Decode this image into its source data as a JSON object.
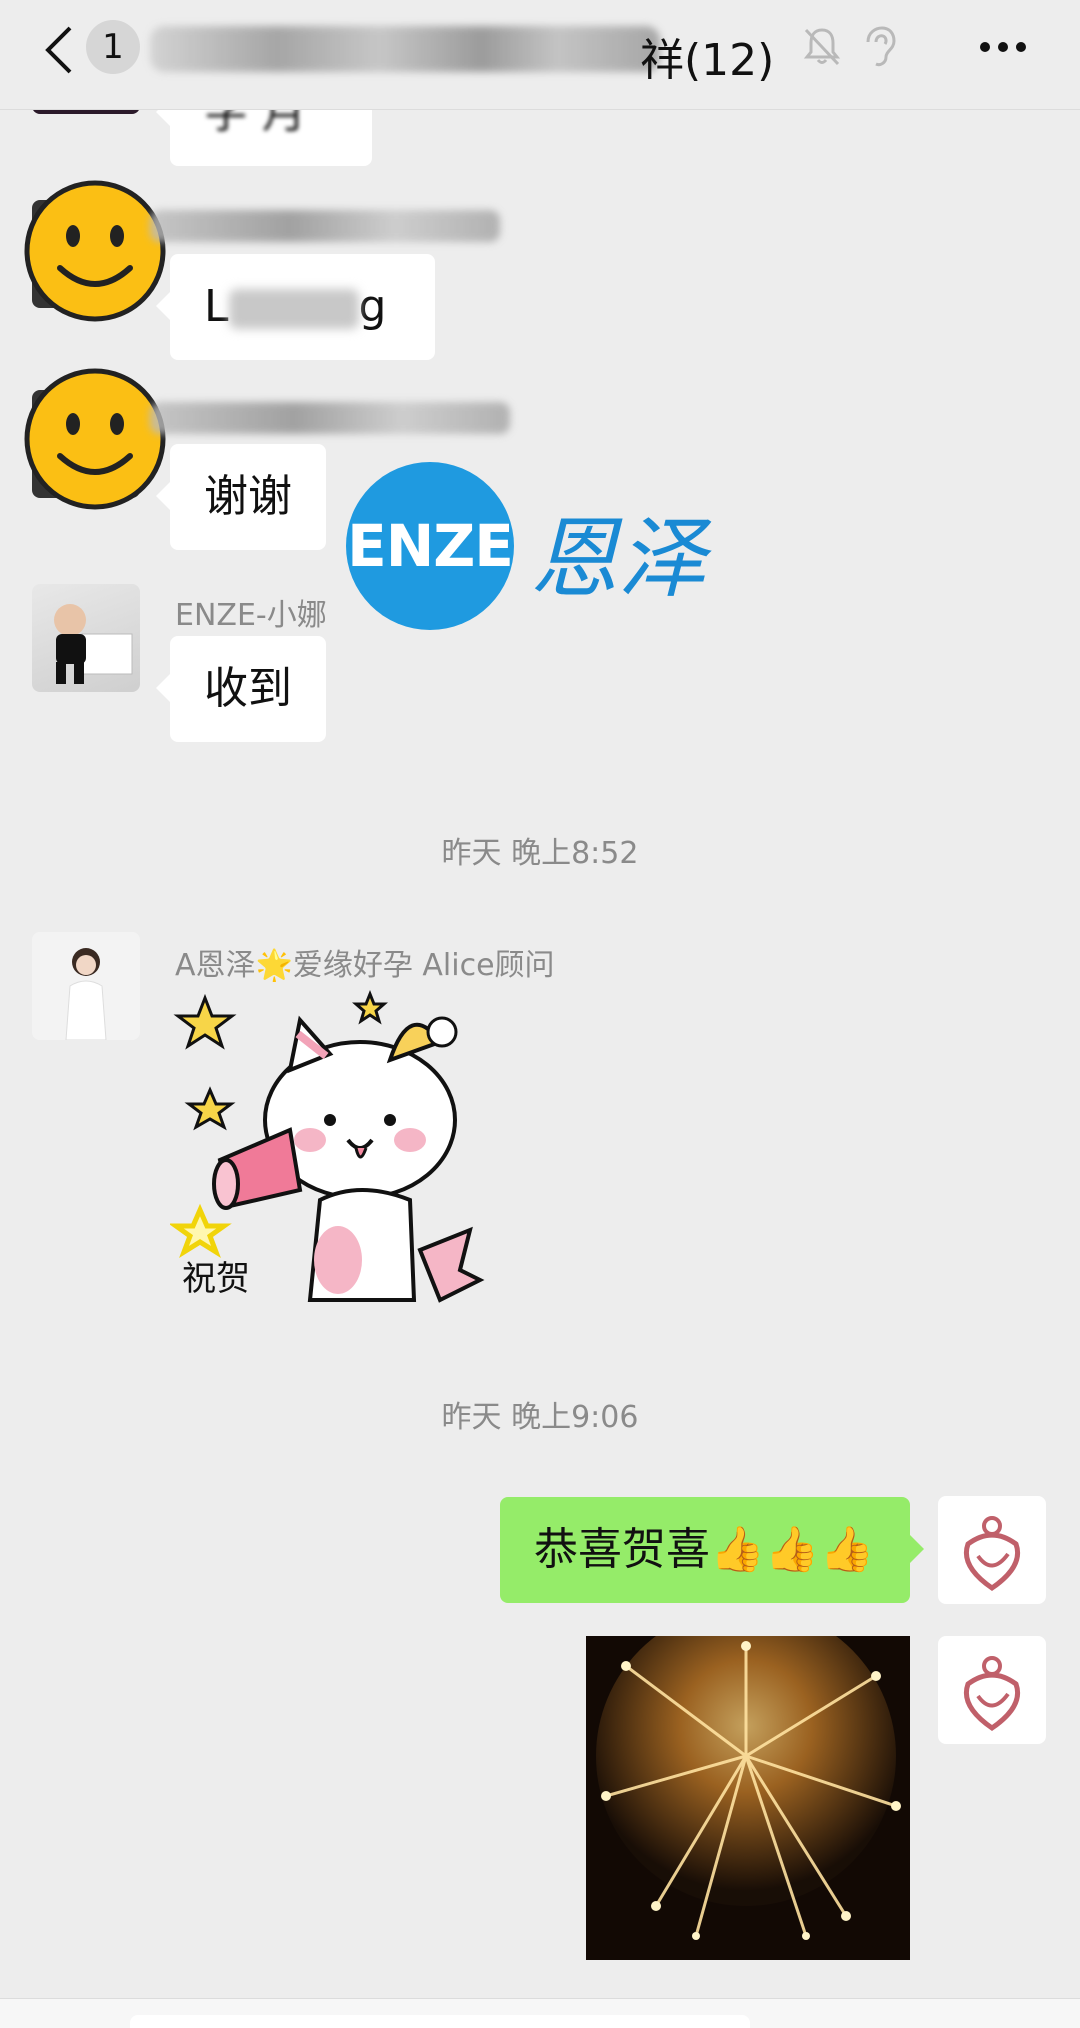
{
  "header": {
    "unread_count": "1",
    "title_suffix": "祥(12)"
  },
  "messages": {
    "m1_text_partial": "字 月",
    "m2_text_prefix": "L",
    "m2_text_suffix": "g",
    "m3_text": "谢谢",
    "m4_sender": "ENZE-小娜",
    "m4_text": "收到",
    "time1": "昨天 晚上8:52",
    "m5_sender": "A恩泽🌟爱缘好孕 Alice顾问",
    "m5_sticker_caption": "祝贺",
    "time2": "昨天 晚上9:06",
    "m6_text": "恭喜贺喜👍👍👍"
  },
  "watermark": {
    "logo_text": "ENZE",
    "brand_text": "恩泽"
  },
  "colors": {
    "bubble_self": "#95ec69",
    "bubble_other": "#ffffff",
    "background": "#ededed",
    "watermark_blue": "#1f9ae0"
  }
}
